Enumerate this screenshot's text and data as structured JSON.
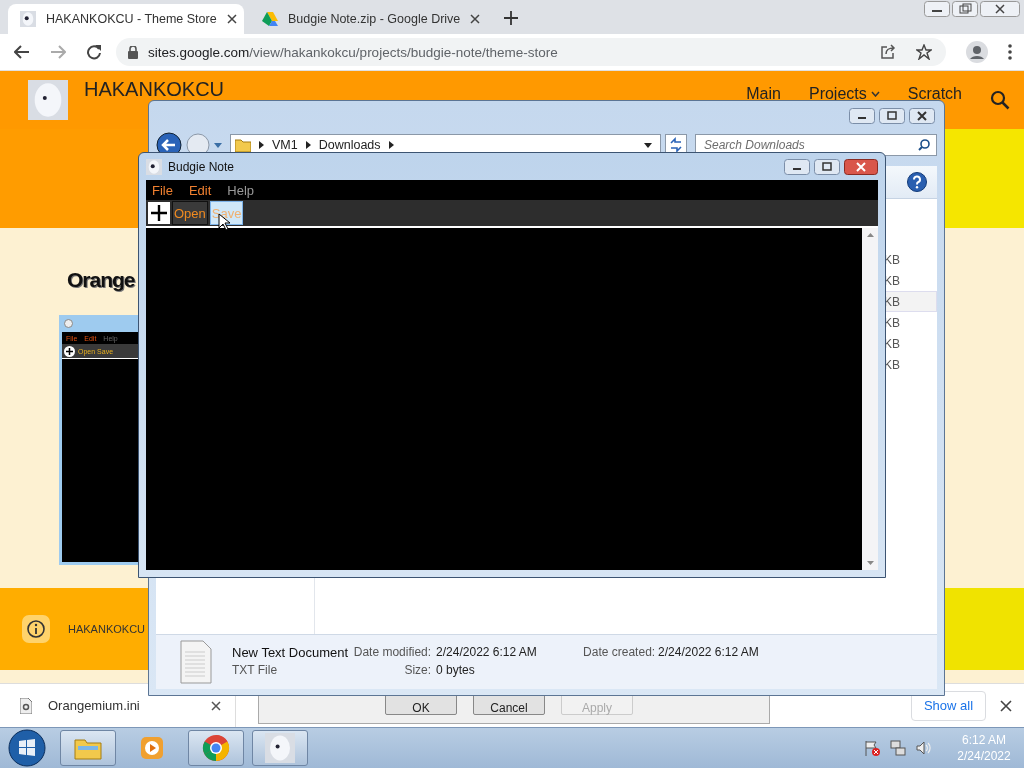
{
  "browser": {
    "tabs": [
      {
        "title": "HAKANKOKCU - Theme Store",
        "selected": true
      },
      {
        "title": "Budgie Note.zip - Google Drive",
        "selected": false
      }
    ],
    "url_domain": "sites.google.com",
    "url_path": "/view/hakankokcu/projects/budgie-note/theme-store"
  },
  "site": {
    "name": "HAKANKOKCU",
    "nav": [
      {
        "label": "Main",
        "dropdown": false
      },
      {
        "label": "Projects",
        "dropdown": true
      },
      {
        "label": "Scratch",
        "dropdown": false
      }
    ],
    "heading": "Orange",
    "thumbnail": {
      "menu": [
        "File",
        "Edit",
        "Help"
      ],
      "toolbar": "Open Save"
    },
    "footer": "HAKANKOKCU"
  },
  "background_dialog": {
    "buttons": [
      {
        "label": "OK",
        "disabled": false
      },
      {
        "label": "Cancel",
        "disabled": false
      },
      {
        "label": "Apply",
        "disabled": true
      }
    ]
  },
  "explorer": {
    "breadcrumb": [
      "VM1",
      "Downloads"
    ],
    "search": {
      "placeholder": "Search Downloads"
    },
    "rows": [
      {
        "size": "KB",
        "selected": false
      },
      {
        "size": "KB",
        "selected": false
      },
      {
        "size": "KB",
        "selected": true
      },
      {
        "size": "KB",
        "selected": false
      },
      {
        "size": "KB",
        "selected": false
      },
      {
        "size": "KB",
        "selected": false
      }
    ],
    "details": {
      "name": "New Text Document",
      "type": "TXT File",
      "fields": [
        {
          "label": "Date modified:",
          "value": "2/24/2022 6:12 AM"
        },
        {
          "label": "Date created:",
          "value": "2/24/2022 6:12 AM"
        },
        {
          "label": "Size:",
          "value": "0 bytes"
        }
      ]
    }
  },
  "budgie_note": {
    "title": "Budgie Note",
    "menu": [
      {
        "label": "File",
        "disabled": false
      },
      {
        "label": "Edit",
        "disabled": false
      },
      {
        "label": "Help",
        "disabled": true
      }
    ],
    "toolbar": [
      {
        "label": "Open",
        "hovered": false
      },
      {
        "label": "Save",
        "hovered": true
      }
    ]
  },
  "downloads": {
    "items": [
      {
        "name": "Orangemium.ini"
      }
    ],
    "show_all": "Show all"
  },
  "taskbar": {
    "apps": [
      {
        "kind": "explorer",
        "running": true
      },
      {
        "kind": "media",
        "running": false
      },
      {
        "kind": "chrome",
        "running": true
      },
      {
        "kind": "budgie",
        "running": true
      }
    ],
    "time": "6:12 AM",
    "date": "2/24/2022"
  }
}
